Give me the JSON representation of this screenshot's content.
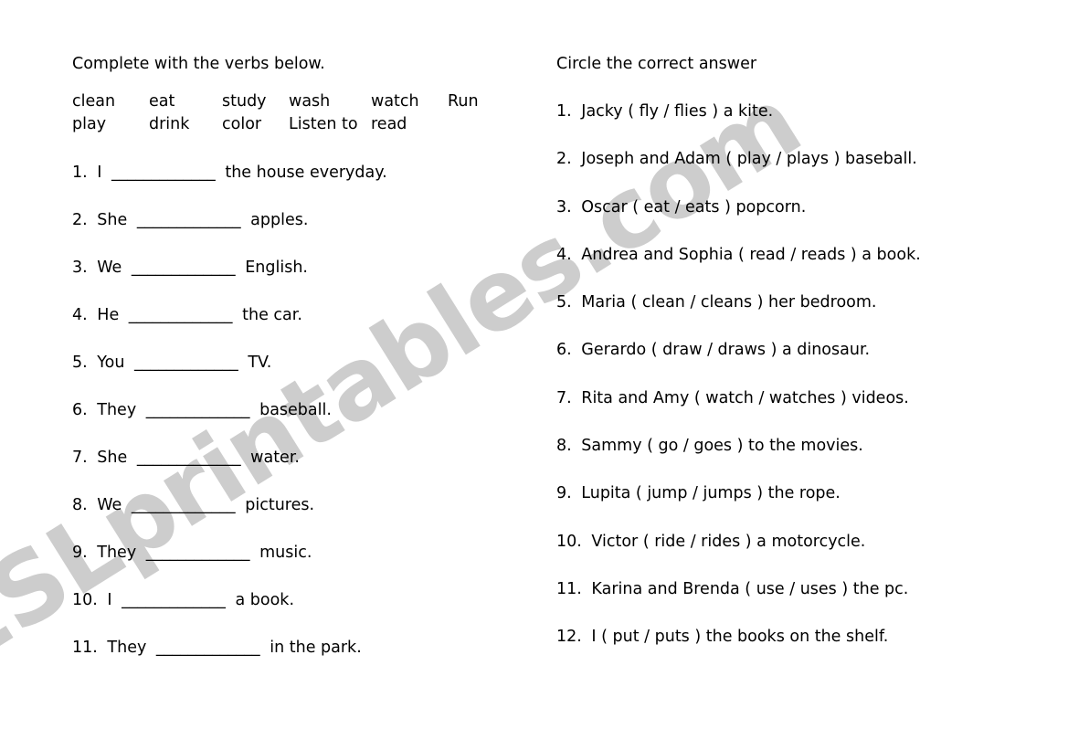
{
  "watermark": {
    "text": "ESLprintables.com",
    "color": "#cdcdcd"
  },
  "page": {
    "background_color": "#ffffff",
    "text_color": "#000000"
  },
  "left_column": {
    "heading": "Complete with the verbs below.",
    "word_bank": {
      "row1": [
        "clean",
        "eat",
        "study",
        "wash",
        "watch",
        "Run"
      ],
      "row2": [
        "play",
        "drink",
        "color",
        "Listen to",
        "read"
      ]
    },
    "questions": [
      {
        "num": "1.",
        "before": "I",
        "blank": "_____________",
        "after": "the house everyday."
      },
      {
        "num": "2.",
        "before": "She",
        "blank": "_____________",
        "after": "apples."
      },
      {
        "num": "3.",
        "before": "We",
        "blank": "_____________",
        "after": "English."
      },
      {
        "num": "4.",
        "before": "He",
        "blank": "_____________",
        "after": "the car."
      },
      {
        "num": "5.",
        "before": "You",
        "blank": "_____________",
        "after": "TV."
      },
      {
        "num": "6.",
        "before": "They",
        "blank": "_____________",
        "after": "baseball."
      },
      {
        "num": "7.",
        "before": "She",
        "blank": "_____________",
        "after": "water."
      },
      {
        "num": "8.",
        "before": "We",
        "blank": "_____________",
        "after": "pictures."
      },
      {
        "num": "9.",
        "before": "They",
        "blank": "_____________",
        "after": "music."
      },
      {
        "num": "10.",
        "before": "I",
        "blank": "_____________",
        "after": "a book."
      },
      {
        "num": "11.",
        "before": "They",
        "blank": "_____________",
        "after": "in the park."
      }
    ]
  },
  "right_column": {
    "heading": "Circle the correct answer",
    "questions": [
      {
        "num": "1.",
        "text": "Jacky ( fly / flies ) a kite."
      },
      {
        "num": "2.",
        "text": "Joseph and Adam ( play / plays ) baseball."
      },
      {
        "num": "3.",
        "text": "Oscar ( eat / eats ) popcorn."
      },
      {
        "num": "4.",
        "text": "Andrea and Sophia ( read / reads ) a book."
      },
      {
        "num": "5.",
        "text": "Maria ( clean / cleans ) her bedroom."
      },
      {
        "num": "6.",
        "text": "Gerardo ( draw / draws ) a dinosaur."
      },
      {
        "num": "7.",
        "text": "Rita and Amy ( watch / watches ) videos."
      },
      {
        "num": "8.",
        "text": "Sammy ( go / goes ) to the movies."
      },
      {
        "num": "9.",
        "text": "Lupita ( jump / jumps ) the rope."
      },
      {
        "num": "10.",
        "text": "Victor ( ride / rides ) a motorcycle."
      },
      {
        "num": "11.",
        "text": "Karina and Brenda ( use / uses ) the pc."
      },
      {
        "num": "12.",
        "text": "I ( put / puts ) the books on the shelf."
      }
    ]
  }
}
